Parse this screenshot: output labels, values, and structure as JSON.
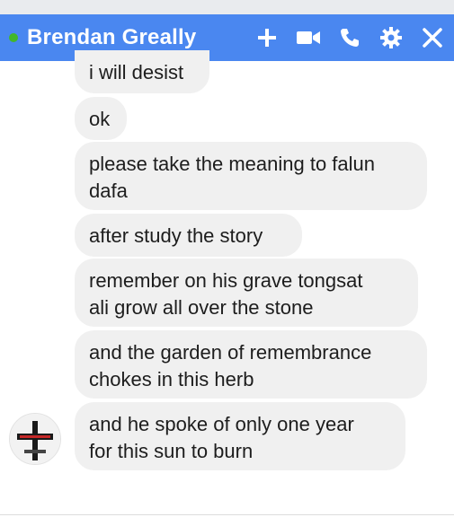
{
  "window": {
    "contact_name": "Brendan Greally",
    "online_status_color": "#42b72a",
    "header_color": "#4a87f0"
  },
  "header": {
    "icons": [
      "add-icon",
      "video-call-icon",
      "phone-icon",
      "settings-icon",
      "close-icon"
    ]
  },
  "messages": [
    {
      "text": "i will desist"
    },
    {
      "text": "ok"
    },
    {
      "text": "please take the meaning to falun\ndafa"
    },
    {
      "text": "after study the story"
    },
    {
      "text": "remember on his grave tongsat\nali grow all over the stone"
    },
    {
      "text": "and the garden of remembrance\nchokes in this herb"
    },
    {
      "text": "and he spoke of only one year\nfor this sun to burn"
    }
  ]
}
